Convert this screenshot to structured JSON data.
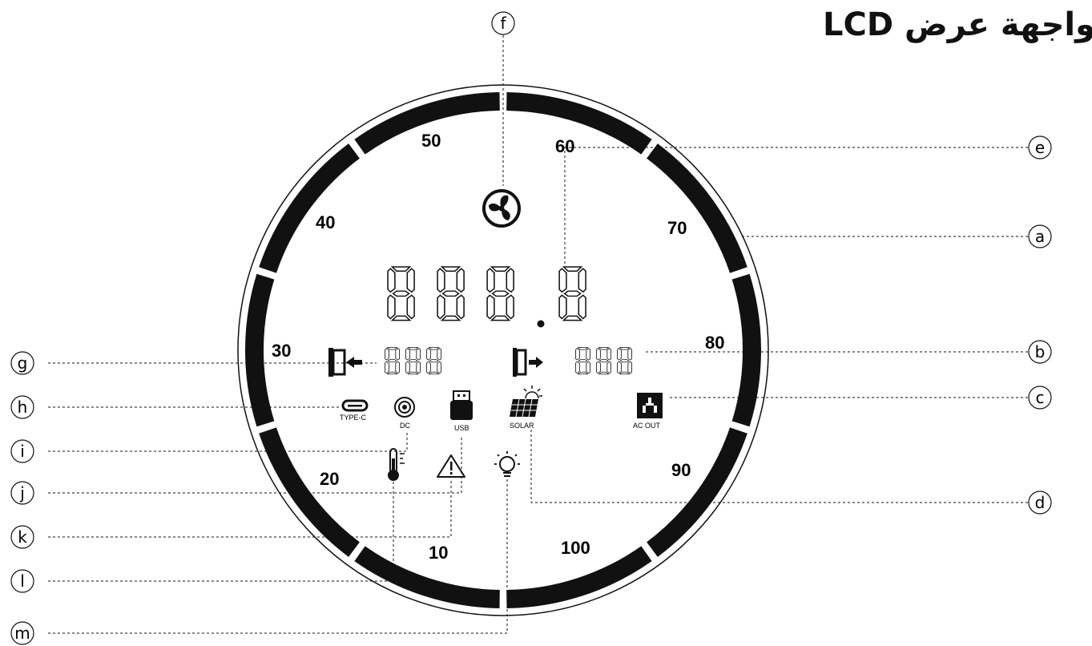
{
  "title": "واجهة عرض LCD",
  "gauge_labels": {
    "l10": "10",
    "l20": "20",
    "l30": "30",
    "l40": "40",
    "l50": "50",
    "l60": "60",
    "l70": "70",
    "l80": "80",
    "l90": "90",
    "l100": "100"
  },
  "icon_captions": {
    "typec": "TYPE-C",
    "dc": "DC",
    "usb": "USB",
    "solar": "SOLAR",
    "ac_out": "AC OUT"
  },
  "callouts": {
    "a": "a",
    "b": "b",
    "c": "c",
    "d": "d",
    "e": "e",
    "f": "f",
    "g": "g",
    "h": "h",
    "i": "i",
    "j": "j",
    "k": "k",
    "l": "l",
    "m": "m"
  },
  "icons": [
    "fan-icon",
    "input-port-icon",
    "output-port-icon",
    "typec-icon",
    "dc-icon",
    "usb-icon",
    "solar-panel-icon",
    "ac-outlet-icon",
    "thermometer-icon",
    "warning-icon",
    "light-bulb-icon"
  ]
}
